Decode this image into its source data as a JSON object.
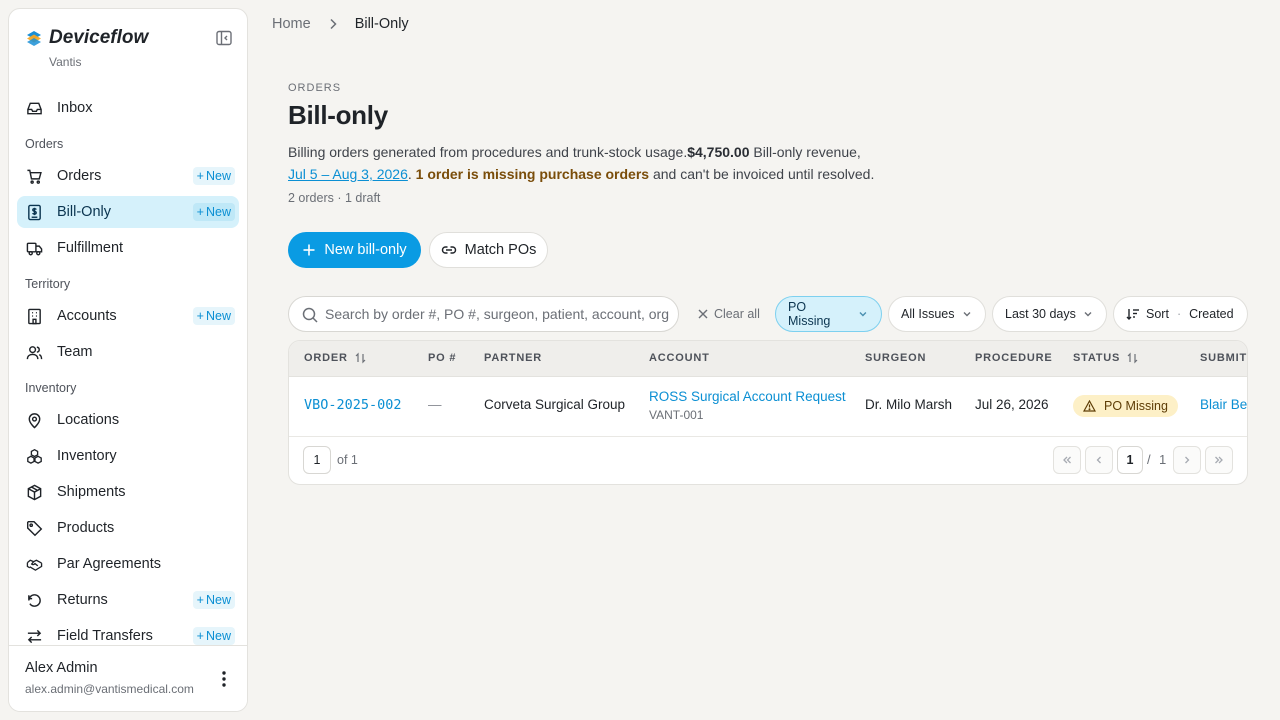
{
  "app": {
    "name": "Deviceflow",
    "org": "Vantis"
  },
  "colors": {
    "accent": "#0a9be3",
    "active_bg": "#d5f1fb",
    "warning_bg": "#fdf0c7",
    "warning_text": "#7a4d0a"
  },
  "sidebar": {
    "new_label": "New",
    "inbox": "Inbox",
    "sections": {
      "orders": "Orders",
      "territory": "Territory",
      "inventory": "Inventory"
    },
    "items": {
      "orders": "Orders",
      "bill_only": "Bill-Only",
      "fulfillment": "Fulfillment",
      "accounts": "Accounts",
      "team": "Team",
      "locations": "Locations",
      "inventory": "Inventory",
      "shipments": "Shipments",
      "products": "Products",
      "par_agreements": "Par Agreements",
      "returns": "Returns",
      "field_transfers": "Field Transfers"
    },
    "user": {
      "name": "Alex Admin",
      "email": "alex.admin@vantismedical.com"
    }
  },
  "breadcrumb": {
    "home": "Home",
    "current": "Bill-Only"
  },
  "header": {
    "eyebrow": "ORDERS",
    "title": "Bill-only",
    "desc_part1": "Billing orders generated from procedures and trunk-stock usage.",
    "revenue": "$4,750.00",
    "desc_part2": " Bill-only revenue,",
    "date_range": "Jul 5 – Aug 3, 2026",
    "desc_part3": ". ",
    "warning": "1 order is missing purchase orders",
    "desc_part4": " and can't be invoiced until resolved.",
    "counts": "2 orders · 1 draft"
  },
  "actions": {
    "new_bill_only": "New bill-only",
    "match_pos": "Match POs"
  },
  "filters": {
    "search_placeholder": "Search by order #, PO #, surgeon, patient, account, org",
    "clear_all": "Clear all",
    "po_missing": "PO Missing",
    "all_issues": "All Issues",
    "date": "Last 30 days",
    "sort": "Sort",
    "sort_sep": "·",
    "sort_by": "Created"
  },
  "table": {
    "columns": [
      "ORDER",
      "PO #",
      "PARTNER",
      "ACCOUNT",
      "SURGEON",
      "PROCEDURE",
      "STATUS",
      "SUBMITTED"
    ],
    "rows": [
      {
        "order": "VBO-2025-002",
        "po": "—",
        "partner": "Corveta Surgical Group",
        "account_name": "ROSS Surgical Account Request",
        "account_code": "VANT-001",
        "surgeon": "Dr. Milo Marsh",
        "procedure": "Jul 26, 2026",
        "status": "PO Missing",
        "submitted": "Blair Bennett"
      }
    ],
    "pagination": {
      "page": "1",
      "of_total": "of 1",
      "current": "1",
      "slash": "/",
      "total": "1"
    }
  }
}
